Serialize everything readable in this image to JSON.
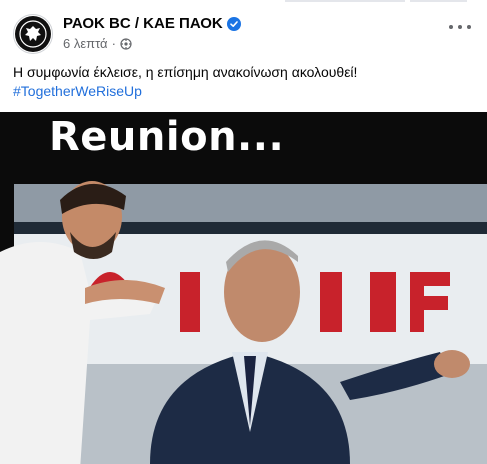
{
  "post": {
    "page_name": "ΡΑΟΚ BC / ΚΑΕ ΠΑΟΚ",
    "time": "6 λεπτά",
    "separator": "·",
    "text": "Η συμφωνία έκλεισε, η επίσημη ανακοίνωση ακολουθεί!",
    "hashtag": "#TogetherWeRiseUp",
    "icons": [
      "verified-badge-icon",
      "globe-icon",
      "more-options-icon"
    ],
    "colors": {
      "verified": "#1b74e4",
      "hashtag": "#216fdb",
      "meta": "#65676b"
    }
  },
  "image": {
    "headline": "Reunion..."
  }
}
